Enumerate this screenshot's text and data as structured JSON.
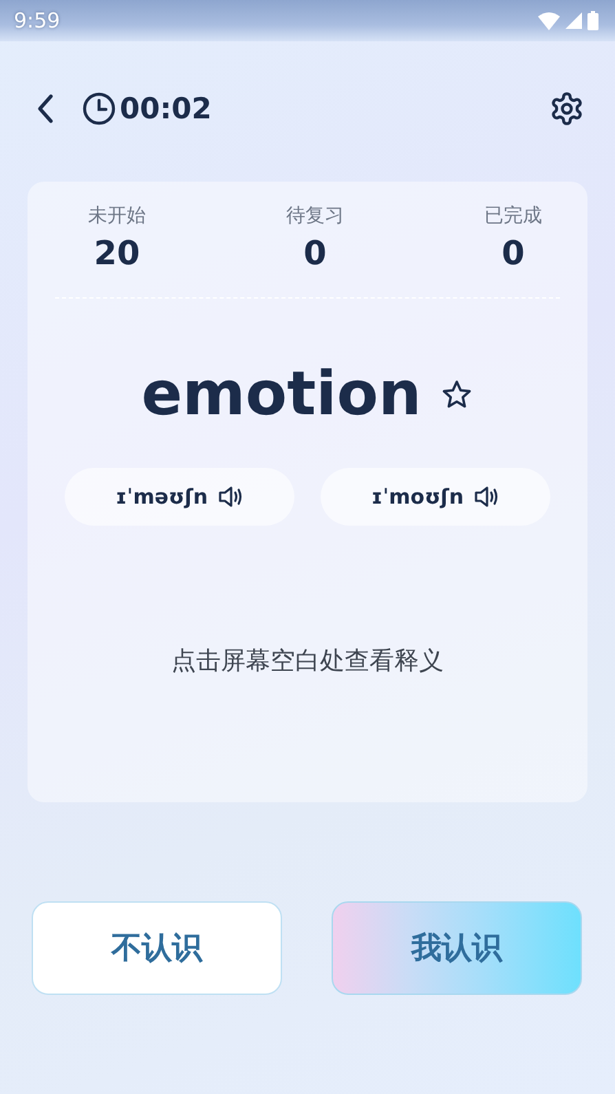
{
  "status_bar": {
    "time": "9:59"
  },
  "header": {
    "timer": "00:02"
  },
  "stats": [
    {
      "label": "未开始",
      "value": "20"
    },
    {
      "label": "待复习",
      "value": "0"
    },
    {
      "label": "已完成",
      "value": "0"
    }
  ],
  "word": {
    "text": "emotion",
    "starred": false
  },
  "pronunciations": [
    {
      "phonetic": "ɪˈməʊʃn"
    },
    {
      "phonetic": "ɪˈmoʊʃn"
    }
  ],
  "hint": "点击屏幕空白处查看释义",
  "actions": [
    {
      "label": "不认识",
      "kind": "outline"
    },
    {
      "label": "我认识",
      "kind": "gradient"
    }
  ]
}
